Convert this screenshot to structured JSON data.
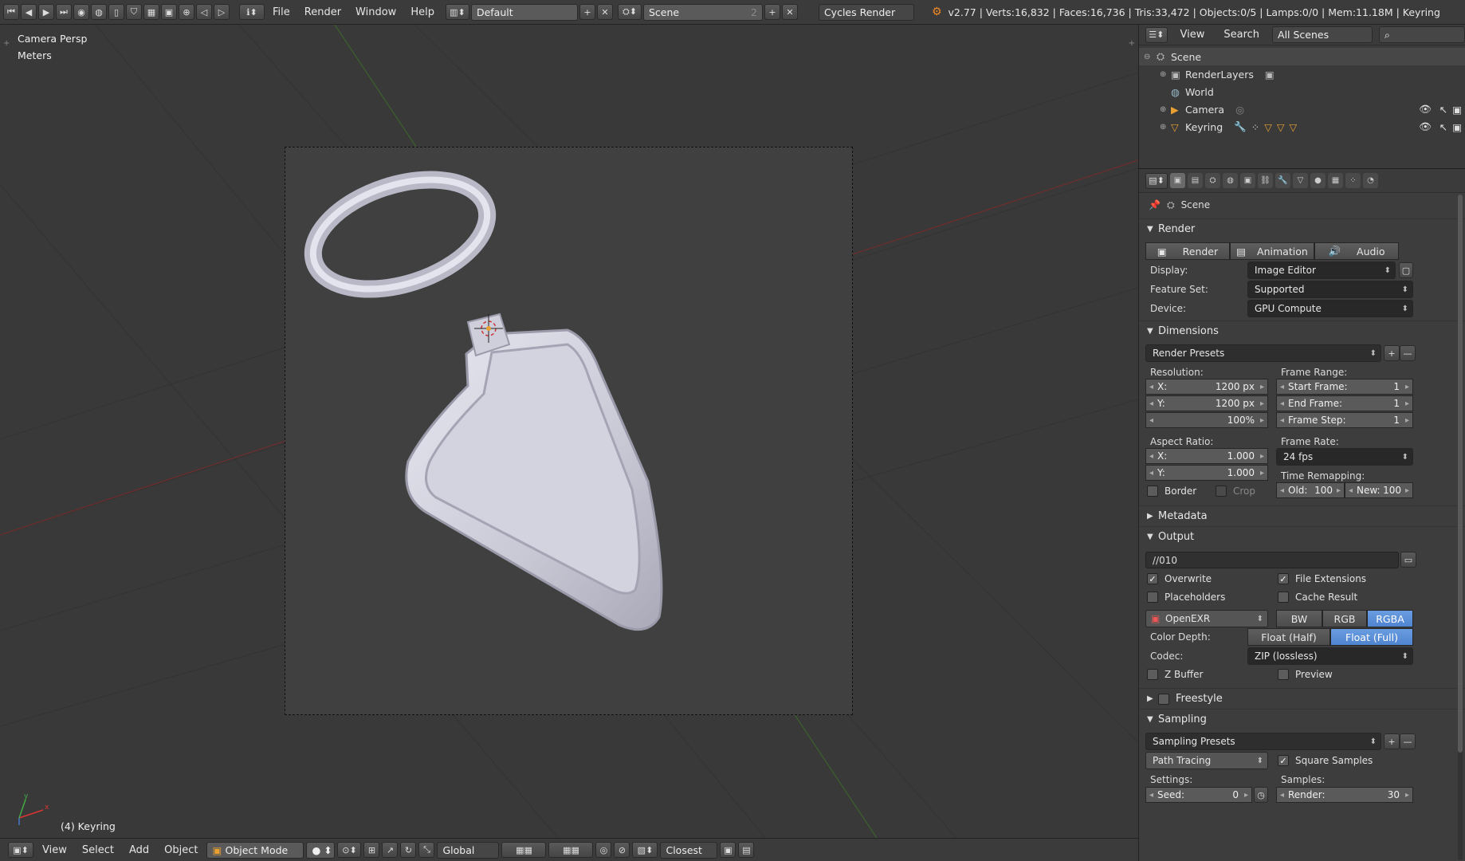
{
  "topbar": {
    "menus": [
      "File",
      "Render",
      "Window",
      "Help"
    ],
    "screen_layout": "Default",
    "scene": "Scene",
    "scene_users": "2",
    "engine": "Cycles Render",
    "stats": "v2.77 | Verts:16,832 | Faces:16,736 | Tris:33,472 | Objects:0/5 | Lamps:0/0 | Mem:11.18M | Keyring"
  },
  "viewport": {
    "view_name": "Camera Persp",
    "units": "Meters",
    "active_object": "(4) Keyring"
  },
  "bottombar": {
    "menus": [
      "View",
      "Select",
      "Add",
      "Object"
    ],
    "mode": "Object Mode",
    "orientation": "Global",
    "snap_target": "Closest"
  },
  "outliner": {
    "menus": [
      "View",
      "Search"
    ],
    "display_mode": "All Scenes",
    "items": [
      {
        "label": "Scene"
      },
      {
        "label": "RenderLayers"
      },
      {
        "label": "World"
      },
      {
        "label": "Camera"
      },
      {
        "label": "Keyring"
      }
    ]
  },
  "properties": {
    "context": "Scene",
    "render": {
      "title": "Render",
      "buttons": [
        "Render",
        "Animation",
        "Audio"
      ],
      "display_label": "Display:",
      "display_value": "Image Editor",
      "feature_set_label": "Feature Set:",
      "feature_set_value": "Supported",
      "device_label": "Device:",
      "device_value": "GPU Compute"
    },
    "dimensions": {
      "title": "Dimensions",
      "presets": "Render Presets",
      "resolution_label": "Resolution:",
      "res_x_label": "X:",
      "res_x": "1200 px",
      "res_y_label": "Y:",
      "res_y": "1200 px",
      "res_pct": "100%",
      "frame_range_label": "Frame Range:",
      "start_label": "Start Frame:",
      "start": "1",
      "end_label": "End Frame:",
      "end": "1",
      "step_label": "Frame Step:",
      "step": "1",
      "aspect_label": "Aspect Ratio:",
      "asp_x_label": "X:",
      "asp_x": "1.000",
      "asp_y_label": "Y:",
      "asp_y": "1.000",
      "frame_rate_label": "Frame Rate:",
      "frame_rate": "24 fps",
      "time_remap_label": "Time Remapping:",
      "old_label": "Old:",
      "old": "100",
      "new_label": "New:",
      "new": "100",
      "border_label": "Border",
      "crop_label": "Crop"
    },
    "metadata_title": "Metadata",
    "output": {
      "title": "Output",
      "path": "//010",
      "overwrite": "Overwrite",
      "file_extensions": "File Extensions",
      "placeholders": "Placeholders",
      "cache_result": "Cache Result",
      "format": "OpenEXR",
      "color_modes": [
        "BW",
        "RGB",
        "RGBA"
      ],
      "color_depth_label": "Color Depth:",
      "depths": [
        "Float (Half)",
        "Float (Full)"
      ],
      "codec_label": "Codec:",
      "codec": "ZIP (lossless)",
      "zbuffer": "Z Buffer",
      "preview": "Preview"
    },
    "freestyle_title": "Freestyle",
    "sampling": {
      "title": "Sampling",
      "presets": "Sampling Presets",
      "integrator": "Path Tracing",
      "square_samples": "Square Samples",
      "settings_label": "Settings:",
      "samples_label": "Samples:",
      "seed_label": "Seed:",
      "seed": "0",
      "render_label": "Render:",
      "render": "30"
    }
  }
}
